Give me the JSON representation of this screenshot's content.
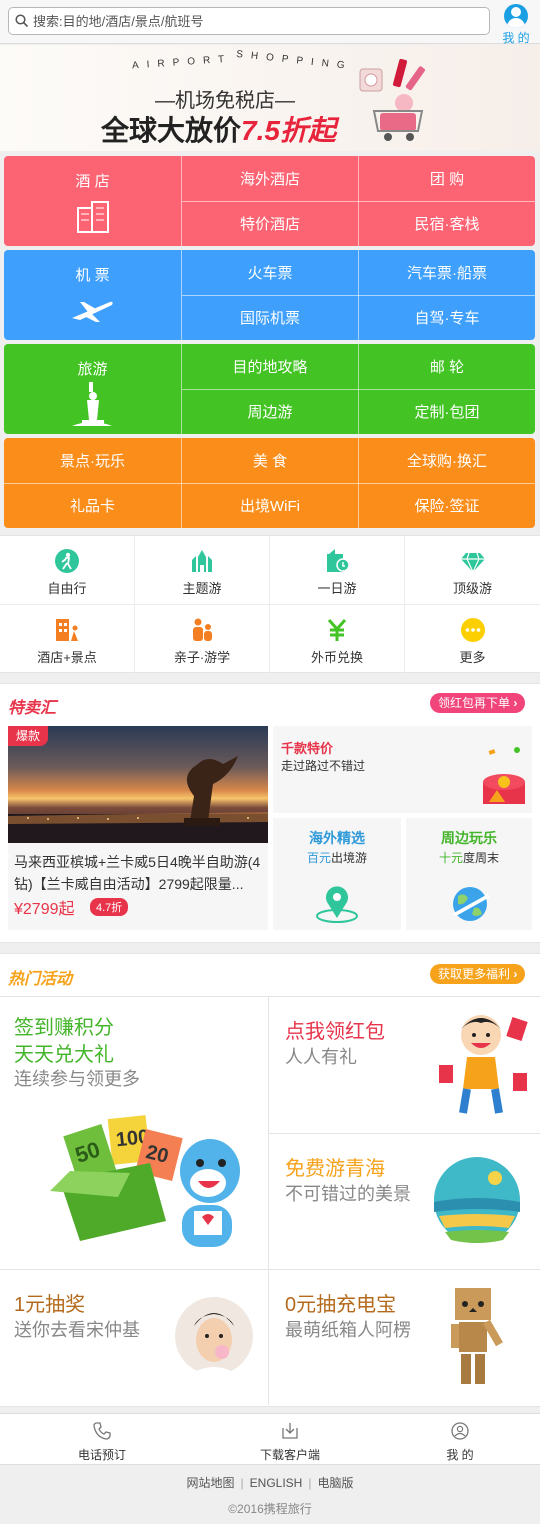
{
  "search": {
    "placeholder": "搜索:目的地/酒店/景点/航班号"
  },
  "me_label": "我 的",
  "banner": {
    "arc_left": "AIRPORT",
    "arc_right": "SHOPPING",
    "subtitle": "—机场免税店—",
    "headline": "全球大放价",
    "highlight": "7.5折起"
  },
  "grid": [
    {
      "color": "#fd6473",
      "main": "酒 店",
      "cells": [
        "海外酒店",
        "团 购",
        "特价酒店",
        "民宿·客栈"
      ]
    },
    {
      "color": "#3e9ffd",
      "main": "机 票",
      "cells": [
        "火车票",
        "汽车票·船票",
        "国际机票",
        "自驾·专车"
      ]
    },
    {
      "color": "#43c424",
      "main": "旅游",
      "cells": [
        "目的地攻略",
        "邮 轮",
        "周边游",
        "定制·包团"
      ]
    },
    {
      "color": "#fb8d1b",
      "cells": [
        "景点·玩乐",
        "美 食",
        "全球购·换汇",
        "礼品卡",
        "出境WiFi",
        "保险·签证"
      ]
    }
  ],
  "icons": [
    {
      "label": "自由行",
      "icon": "free-travel-icon"
    },
    {
      "label": "主题游",
      "icon": "theme-tour-icon"
    },
    {
      "label": "一日游",
      "icon": "day-tour-icon"
    },
    {
      "label": "顶级游",
      "icon": "diamond-icon"
    },
    {
      "label": "酒店+景点",
      "icon": "hotel-scenic-icon"
    },
    {
      "label": "亲子·游学",
      "icon": "family-icon"
    },
    {
      "label": "外币兑换",
      "icon": "currency-icon"
    },
    {
      "label": "更多",
      "icon": "more-icon"
    }
  ],
  "sale": {
    "title": "特卖汇",
    "pill": "领红包再下单",
    "badge": "爆款",
    "product_title": "马来西亚槟城+兰卡威5日4晚半自助游(4钻)【兰卡威自由活动】2799起限量...",
    "price": "¥2799起",
    "discount": "4.7折",
    "box1_title": "千款特价",
    "box1_sub": "走过路过不错过",
    "box2_title": "海外精选",
    "box2_hl": "百元",
    "box2_sub": "出境游",
    "box3_title": "周边玩乐",
    "box3_hl": "十元",
    "box3_sub": "度周末"
  },
  "hot": {
    "title": "热门活动",
    "pill": "获取更多福利",
    "a1_l1": "签到赚积分",
    "a1_l2": "天天兑大礼",
    "a1_l3": "连续参与领更多",
    "a2_l1": "点我领红包",
    "a2_l2": "人人有礼",
    "a3_l1": "免费游青海",
    "a3_l2": "不可错过的美景",
    "a4_l1": "1元抽奖",
    "a4_l2": "送你去看宋仲基",
    "a5_l1": "0元抽充电宝",
    "a5_l2": "最萌纸箱人阿楞"
  },
  "bottom_nav": [
    {
      "label": "电话预订",
      "icon": "phone-icon"
    },
    {
      "label": "下载客户端",
      "icon": "download-icon"
    },
    {
      "label": "我 的",
      "icon": "user-icon"
    }
  ],
  "footer": {
    "links": [
      "网站地图",
      "ENGLISH",
      "电脑版"
    ],
    "copyright": "©2016携程旅行"
  }
}
